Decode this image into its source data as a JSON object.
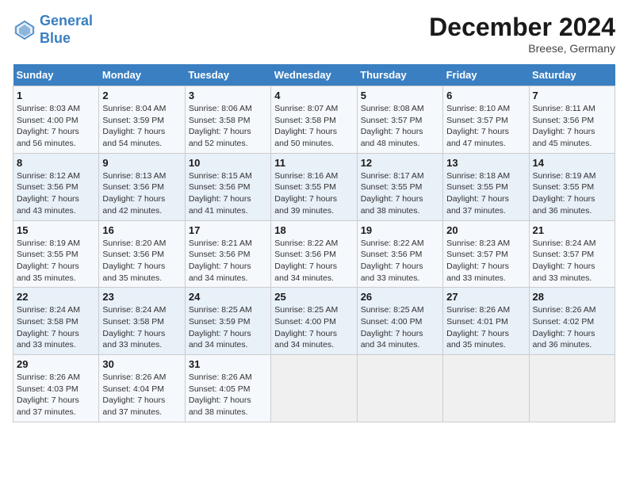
{
  "header": {
    "logo_line1": "General",
    "logo_line2": "Blue",
    "month": "December 2024",
    "location": "Breese, Germany"
  },
  "days_of_week": [
    "Sunday",
    "Monday",
    "Tuesday",
    "Wednesday",
    "Thursday",
    "Friday",
    "Saturday"
  ],
  "weeks": [
    [
      {
        "day": "1",
        "sunrise": "8:03 AM",
        "sunset": "4:00 PM",
        "daylight": "7 hours and 56 minutes."
      },
      {
        "day": "2",
        "sunrise": "8:04 AM",
        "sunset": "3:59 PM",
        "daylight": "7 hours and 54 minutes."
      },
      {
        "day": "3",
        "sunrise": "8:06 AM",
        "sunset": "3:58 PM",
        "daylight": "7 hours and 52 minutes."
      },
      {
        "day": "4",
        "sunrise": "8:07 AM",
        "sunset": "3:58 PM",
        "daylight": "7 hours and 50 minutes."
      },
      {
        "day": "5",
        "sunrise": "8:08 AM",
        "sunset": "3:57 PM",
        "daylight": "7 hours and 48 minutes."
      },
      {
        "day": "6",
        "sunrise": "8:10 AM",
        "sunset": "3:57 PM",
        "daylight": "7 hours and 47 minutes."
      },
      {
        "day": "7",
        "sunrise": "8:11 AM",
        "sunset": "3:56 PM",
        "daylight": "7 hours and 45 minutes."
      }
    ],
    [
      {
        "day": "8",
        "sunrise": "8:12 AM",
        "sunset": "3:56 PM",
        "daylight": "7 hours and 43 minutes."
      },
      {
        "day": "9",
        "sunrise": "8:13 AM",
        "sunset": "3:56 PM",
        "daylight": "7 hours and 42 minutes."
      },
      {
        "day": "10",
        "sunrise": "8:15 AM",
        "sunset": "3:56 PM",
        "daylight": "7 hours and 41 minutes."
      },
      {
        "day": "11",
        "sunrise": "8:16 AM",
        "sunset": "3:55 PM",
        "daylight": "7 hours and 39 minutes."
      },
      {
        "day": "12",
        "sunrise": "8:17 AM",
        "sunset": "3:55 PM",
        "daylight": "7 hours and 38 minutes."
      },
      {
        "day": "13",
        "sunrise": "8:18 AM",
        "sunset": "3:55 PM",
        "daylight": "7 hours and 37 minutes."
      },
      {
        "day": "14",
        "sunrise": "8:19 AM",
        "sunset": "3:55 PM",
        "daylight": "7 hours and 36 minutes."
      }
    ],
    [
      {
        "day": "15",
        "sunrise": "8:19 AM",
        "sunset": "3:55 PM",
        "daylight": "7 hours and 35 minutes."
      },
      {
        "day": "16",
        "sunrise": "8:20 AM",
        "sunset": "3:56 PM",
        "daylight": "7 hours and 35 minutes."
      },
      {
        "day": "17",
        "sunrise": "8:21 AM",
        "sunset": "3:56 PM",
        "daylight": "7 hours and 34 minutes."
      },
      {
        "day": "18",
        "sunrise": "8:22 AM",
        "sunset": "3:56 PM",
        "daylight": "7 hours and 34 minutes."
      },
      {
        "day": "19",
        "sunrise": "8:22 AM",
        "sunset": "3:56 PM",
        "daylight": "7 hours and 33 minutes."
      },
      {
        "day": "20",
        "sunrise": "8:23 AM",
        "sunset": "3:57 PM",
        "daylight": "7 hours and 33 minutes."
      },
      {
        "day": "21",
        "sunrise": "8:24 AM",
        "sunset": "3:57 PM",
        "daylight": "7 hours and 33 minutes."
      }
    ],
    [
      {
        "day": "22",
        "sunrise": "8:24 AM",
        "sunset": "3:58 PM",
        "daylight": "7 hours and 33 minutes."
      },
      {
        "day": "23",
        "sunrise": "8:24 AM",
        "sunset": "3:58 PM",
        "daylight": "7 hours and 33 minutes."
      },
      {
        "day": "24",
        "sunrise": "8:25 AM",
        "sunset": "3:59 PM",
        "daylight": "7 hours and 34 minutes."
      },
      {
        "day": "25",
        "sunrise": "8:25 AM",
        "sunset": "4:00 PM",
        "daylight": "7 hours and 34 minutes."
      },
      {
        "day": "26",
        "sunrise": "8:25 AM",
        "sunset": "4:00 PM",
        "daylight": "7 hours and 34 minutes."
      },
      {
        "day": "27",
        "sunrise": "8:26 AM",
        "sunset": "4:01 PM",
        "daylight": "7 hours and 35 minutes."
      },
      {
        "day": "28",
        "sunrise": "8:26 AM",
        "sunset": "4:02 PM",
        "daylight": "7 hours and 36 minutes."
      }
    ],
    [
      {
        "day": "29",
        "sunrise": "8:26 AM",
        "sunset": "4:03 PM",
        "daylight": "7 hours and 37 minutes."
      },
      {
        "day": "30",
        "sunrise": "8:26 AM",
        "sunset": "4:04 PM",
        "daylight": "7 hours and 37 minutes."
      },
      {
        "day": "31",
        "sunrise": "8:26 AM",
        "sunset": "4:05 PM",
        "daylight": "7 hours and 38 minutes."
      },
      null,
      null,
      null,
      null
    ]
  ]
}
